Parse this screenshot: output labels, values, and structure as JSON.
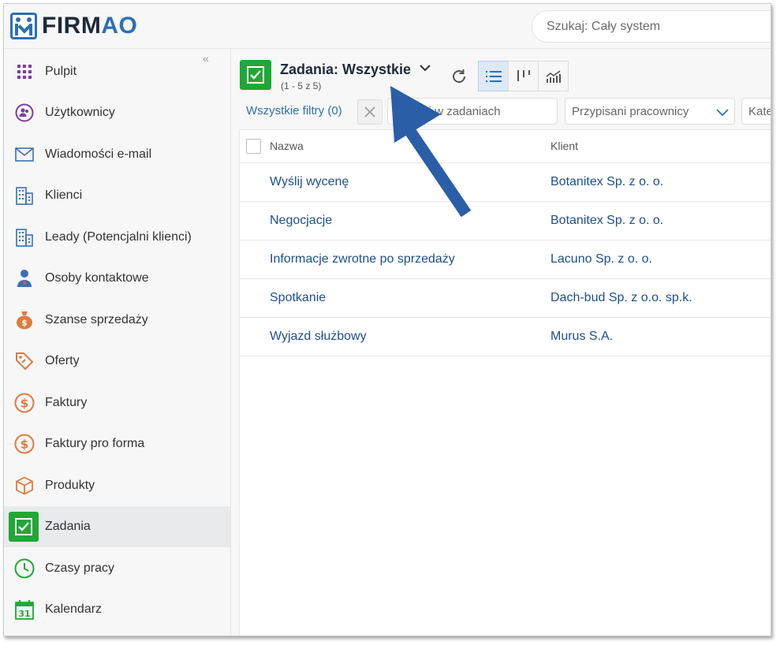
{
  "app": {
    "brand_prefix": "FIRM",
    "brand_suffix": "AO",
    "search_placeholder": "Szukaj: Cały system"
  },
  "sidebar": {
    "items": [
      {
        "label": "Pulpit",
        "icon": "grid-dots-icon"
      },
      {
        "label": "Użytkownicy",
        "icon": "users-circle-icon"
      },
      {
        "label": "Wiadomości e-mail",
        "icon": "envelope-icon"
      },
      {
        "label": "Klienci",
        "icon": "building-icon"
      },
      {
        "label": "Leady (Potencjalni klienci)",
        "icon": "building-icon"
      },
      {
        "label": "Osoby kontaktowe",
        "icon": "person-icon"
      },
      {
        "label": "Szanse sprzedaży",
        "icon": "money-bag-icon"
      },
      {
        "label": "Oferty",
        "icon": "tag-icon"
      },
      {
        "label": "Faktury",
        "icon": "dollar-coin-icon"
      },
      {
        "label": "Faktury pro forma",
        "icon": "dollar-coin-icon"
      },
      {
        "label": "Produkty",
        "icon": "box-icon"
      },
      {
        "label": "Zadania",
        "icon": "checkbox-icon",
        "active": true
      },
      {
        "label": "Czasy pracy",
        "icon": "clock-icon"
      },
      {
        "label": "Kalendarz",
        "icon": "calendar-icon"
      }
    ],
    "calendar_day": "31"
  },
  "header": {
    "title": "Zadania: Wszystkie",
    "subtitle": "(1 - 5 z 5)"
  },
  "filters": {
    "all_filters": "Wszystkie filtry (0)",
    "search_text": "Szukaj w zadaniach",
    "assigned": "Przypisani pracownicy",
    "category": "Kategoria"
  },
  "table": {
    "columns": [
      "Nazwa",
      "Klient"
    ],
    "rows": [
      {
        "name": "Wyślij wycenę",
        "client": "Botanitex Sp. z o. o."
      },
      {
        "name": "Negocjacje",
        "client": "Botanitex Sp. z o. o."
      },
      {
        "name": "Informacje zwrotne po sprzedaży",
        "client": "Lacuno Sp. z o. o."
      },
      {
        "name": "Spotkanie",
        "client": "Dach-bud Sp. z o.o. sp.k."
      },
      {
        "name": "Wyjazd służbowy",
        "client": "Murus S.A."
      }
    ]
  },
  "colors": {
    "brand": "#2d6fb3",
    "accent_green": "#1fa836",
    "link": "#1e4f8c",
    "annotation_arrow": "#2a5ea6"
  }
}
